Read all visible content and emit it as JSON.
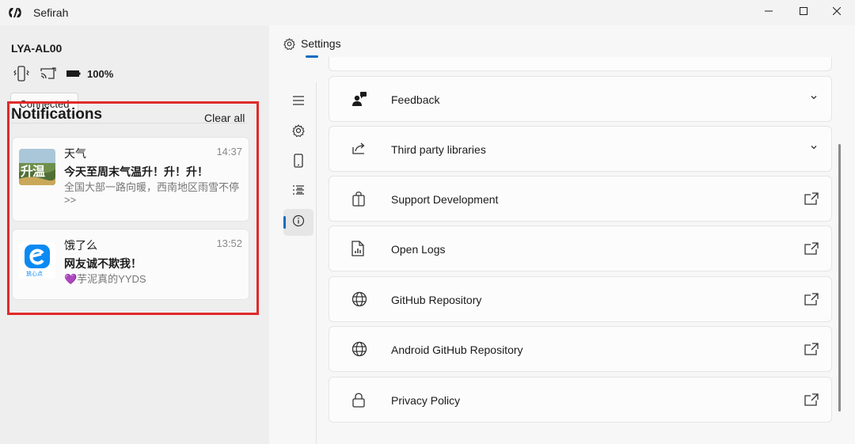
{
  "window": {
    "title": "Sefirah"
  },
  "device": {
    "name": "LYA-AL00",
    "battery": "100%",
    "connection_status": "Connected"
  },
  "notifications": {
    "header": "Notifications",
    "clear_all": "Clear all",
    "items": [
      {
        "app": "天气",
        "time": "14:37",
        "title": "今天至周末气温升！升！升！",
        "body": "全国大部一路向暖，西南地区雨雪不停>>",
        "icon_text": "升温"
      },
      {
        "app": "饿了么",
        "time": "13:52",
        "title": "网友诚不欺我！",
        "body": "💜芋泥真的YYDS",
        "icon_text": "放心点"
      }
    ]
  },
  "settings": {
    "tab_label": "Settings",
    "items": [
      {
        "label": "Feedback",
        "icon": "feedback-icon",
        "action": "chevron-down-icon"
      },
      {
        "label": "Third party libraries",
        "icon": "share-icon",
        "action": "chevron-down-icon"
      },
      {
        "label": "Support Development",
        "icon": "shopping-bag-icon",
        "action": "open-external-icon"
      },
      {
        "label": "Open Logs",
        "icon": "log-file-icon",
        "action": "open-external-icon"
      },
      {
        "label": "GitHub Repository",
        "icon": "globe-icon",
        "action": "open-external-icon"
      },
      {
        "label": "Android GitHub Repository",
        "icon": "globe-icon",
        "action": "open-external-icon"
      },
      {
        "label": "Privacy Policy",
        "icon": "lock-icon",
        "action": "open-external-icon"
      }
    ]
  },
  "nav_rail": {
    "items": [
      "menu-icon",
      "settings-icon",
      "phone-icon",
      "list-icon",
      "info-icon"
    ],
    "active": "info-icon"
  },
  "colors": {
    "accent": "#0f6cbd",
    "highlight": "#e02a2a"
  }
}
